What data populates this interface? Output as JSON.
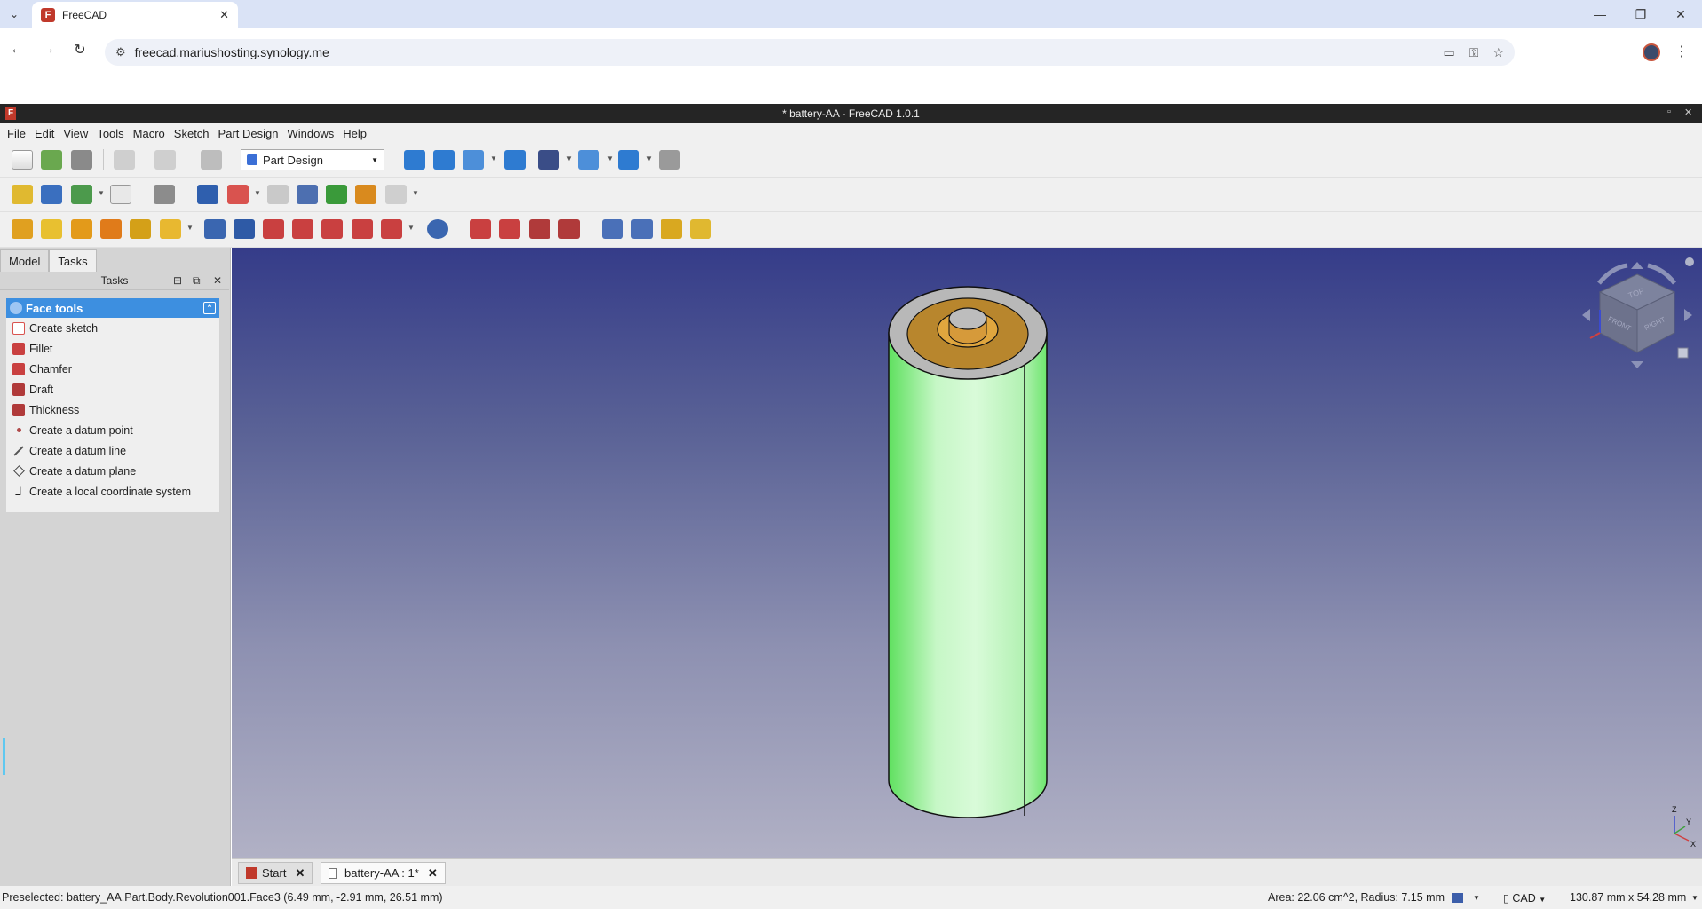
{
  "browser": {
    "tab_title": "FreeCAD",
    "url": "freecad.mariushosting.synology.me"
  },
  "window": {
    "title": "* battery-AA - FreeCAD 1.0.1"
  },
  "menu": [
    "File",
    "Edit",
    "View",
    "Tools",
    "Macro",
    "Sketch",
    "Part Design",
    "Windows",
    "Help"
  ],
  "workbench": "Part Design",
  "panel": {
    "tabs": [
      "Model",
      "Tasks"
    ],
    "header": "Tasks",
    "group_title": "Face tools",
    "items": [
      {
        "label": "Create sketch",
        "icon": "sketch-icon"
      },
      {
        "label": "Fillet",
        "icon": "fillet-icon"
      },
      {
        "label": "Chamfer",
        "icon": "chamfer-icon"
      },
      {
        "label": "Draft",
        "icon": "draft-icon"
      },
      {
        "label": "Thickness",
        "icon": "thickness-icon"
      },
      {
        "label": "Create a datum point",
        "icon": "datum-point-icon"
      },
      {
        "label": "Create a datum line",
        "icon": "datum-line-icon"
      },
      {
        "label": "Create a datum plane",
        "icon": "datum-plane-icon"
      },
      {
        "label": "Create a local coordinate system",
        "icon": "lcs-icon"
      }
    ]
  },
  "navcube": {
    "top": "TOP",
    "front": "FRONT",
    "right": "RIGHT"
  },
  "axes": {
    "x": "X",
    "y": "Y",
    "z": "Z"
  },
  "doc_tabs": [
    "Start",
    "battery-AA : 1*"
  ],
  "status": {
    "message": "Preselected: battery_AA.Part.Body.Revolution001.Face3 (6.49 mm, -2.91 mm, 26.51 mm)",
    "info": "Area: 22.06 cm^2, Radius: 7.15 mm",
    "nav_style": "CAD",
    "dimensions": "130.87 mm x 54.28 mm"
  },
  "colors": {
    "battery_body": "#7ef07e",
    "battery_cap": "#b8862d",
    "task_header": "#3d8fe0"
  }
}
